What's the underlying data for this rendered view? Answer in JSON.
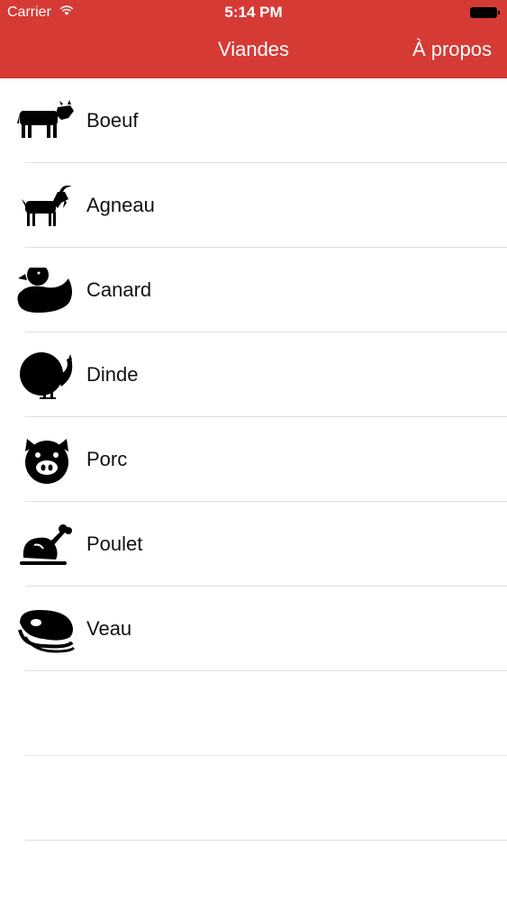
{
  "status_bar": {
    "carrier": "Carrier",
    "time": "5:14 PM"
  },
  "nav": {
    "title": "Viandes",
    "about": "À propos",
    "color": "#d63a35"
  },
  "items": [
    {
      "label": "Boeuf",
      "icon": "cow-icon"
    },
    {
      "label": "Agneau",
      "icon": "goat-icon"
    },
    {
      "label": "Canard",
      "icon": "duck-icon"
    },
    {
      "label": "Dinde",
      "icon": "turkey-icon"
    },
    {
      "label": "Porc",
      "icon": "pig-icon"
    },
    {
      "label": "Poulet",
      "icon": "roast-chicken-icon"
    },
    {
      "label": "Veau",
      "icon": "steak-icon"
    }
  ]
}
